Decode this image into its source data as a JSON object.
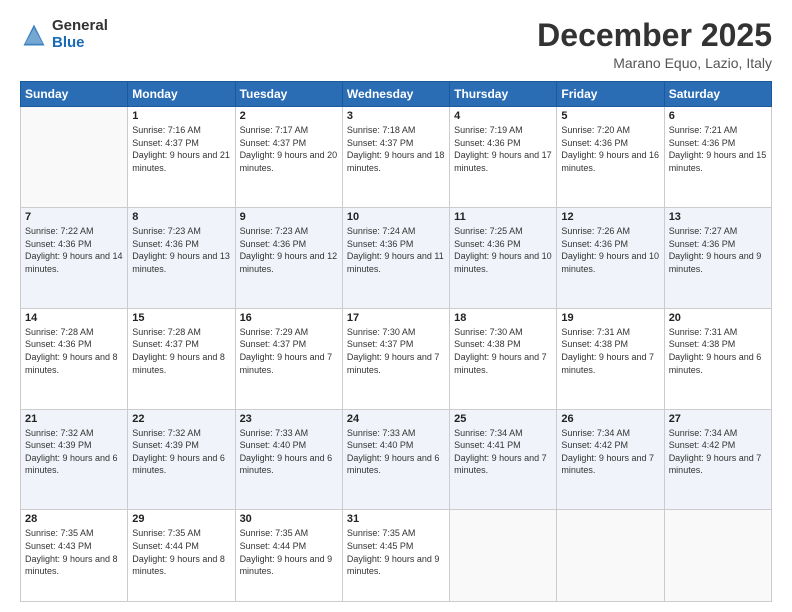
{
  "header": {
    "logo": {
      "line1": "General",
      "line2": "Blue"
    },
    "title": "December 2025",
    "location": "Marano Equo, Lazio, Italy"
  },
  "days_of_week": [
    "Sunday",
    "Monday",
    "Tuesday",
    "Wednesday",
    "Thursday",
    "Friday",
    "Saturday"
  ],
  "weeks": [
    [
      {
        "day": "",
        "sunrise": "",
        "sunset": "",
        "daylight": ""
      },
      {
        "day": "1",
        "sunrise": "Sunrise: 7:16 AM",
        "sunset": "Sunset: 4:37 PM",
        "daylight": "Daylight: 9 hours and 21 minutes."
      },
      {
        "day": "2",
        "sunrise": "Sunrise: 7:17 AM",
        "sunset": "Sunset: 4:37 PM",
        "daylight": "Daylight: 9 hours and 20 minutes."
      },
      {
        "day": "3",
        "sunrise": "Sunrise: 7:18 AM",
        "sunset": "Sunset: 4:37 PM",
        "daylight": "Daylight: 9 hours and 18 minutes."
      },
      {
        "day": "4",
        "sunrise": "Sunrise: 7:19 AM",
        "sunset": "Sunset: 4:36 PM",
        "daylight": "Daylight: 9 hours and 17 minutes."
      },
      {
        "day": "5",
        "sunrise": "Sunrise: 7:20 AM",
        "sunset": "Sunset: 4:36 PM",
        "daylight": "Daylight: 9 hours and 16 minutes."
      },
      {
        "day": "6",
        "sunrise": "Sunrise: 7:21 AM",
        "sunset": "Sunset: 4:36 PM",
        "daylight": "Daylight: 9 hours and 15 minutes."
      }
    ],
    [
      {
        "day": "7",
        "sunrise": "Sunrise: 7:22 AM",
        "sunset": "Sunset: 4:36 PM",
        "daylight": "Daylight: 9 hours and 14 minutes."
      },
      {
        "day": "8",
        "sunrise": "Sunrise: 7:23 AM",
        "sunset": "Sunset: 4:36 PM",
        "daylight": "Daylight: 9 hours and 13 minutes."
      },
      {
        "day": "9",
        "sunrise": "Sunrise: 7:23 AM",
        "sunset": "Sunset: 4:36 PM",
        "daylight": "Daylight: 9 hours and 12 minutes."
      },
      {
        "day": "10",
        "sunrise": "Sunrise: 7:24 AM",
        "sunset": "Sunset: 4:36 PM",
        "daylight": "Daylight: 9 hours and 11 minutes."
      },
      {
        "day": "11",
        "sunrise": "Sunrise: 7:25 AM",
        "sunset": "Sunset: 4:36 PM",
        "daylight": "Daylight: 9 hours and 10 minutes."
      },
      {
        "day": "12",
        "sunrise": "Sunrise: 7:26 AM",
        "sunset": "Sunset: 4:36 PM",
        "daylight": "Daylight: 9 hours and 10 minutes."
      },
      {
        "day": "13",
        "sunrise": "Sunrise: 7:27 AM",
        "sunset": "Sunset: 4:36 PM",
        "daylight": "Daylight: 9 hours and 9 minutes."
      }
    ],
    [
      {
        "day": "14",
        "sunrise": "Sunrise: 7:28 AM",
        "sunset": "Sunset: 4:36 PM",
        "daylight": "Daylight: 9 hours and 8 minutes."
      },
      {
        "day": "15",
        "sunrise": "Sunrise: 7:28 AM",
        "sunset": "Sunset: 4:37 PM",
        "daylight": "Daylight: 9 hours and 8 minutes."
      },
      {
        "day": "16",
        "sunrise": "Sunrise: 7:29 AM",
        "sunset": "Sunset: 4:37 PM",
        "daylight": "Daylight: 9 hours and 7 minutes."
      },
      {
        "day": "17",
        "sunrise": "Sunrise: 7:30 AM",
        "sunset": "Sunset: 4:37 PM",
        "daylight": "Daylight: 9 hours and 7 minutes."
      },
      {
        "day": "18",
        "sunrise": "Sunrise: 7:30 AM",
        "sunset": "Sunset: 4:38 PM",
        "daylight": "Daylight: 9 hours and 7 minutes."
      },
      {
        "day": "19",
        "sunrise": "Sunrise: 7:31 AM",
        "sunset": "Sunset: 4:38 PM",
        "daylight": "Daylight: 9 hours and 7 minutes."
      },
      {
        "day": "20",
        "sunrise": "Sunrise: 7:31 AM",
        "sunset": "Sunset: 4:38 PM",
        "daylight": "Daylight: 9 hours and 6 minutes."
      }
    ],
    [
      {
        "day": "21",
        "sunrise": "Sunrise: 7:32 AM",
        "sunset": "Sunset: 4:39 PM",
        "daylight": "Daylight: 9 hours and 6 minutes."
      },
      {
        "day": "22",
        "sunrise": "Sunrise: 7:32 AM",
        "sunset": "Sunset: 4:39 PM",
        "daylight": "Daylight: 9 hours and 6 minutes."
      },
      {
        "day": "23",
        "sunrise": "Sunrise: 7:33 AM",
        "sunset": "Sunset: 4:40 PM",
        "daylight": "Daylight: 9 hours and 6 minutes."
      },
      {
        "day": "24",
        "sunrise": "Sunrise: 7:33 AM",
        "sunset": "Sunset: 4:40 PM",
        "daylight": "Daylight: 9 hours and 6 minutes."
      },
      {
        "day": "25",
        "sunrise": "Sunrise: 7:34 AM",
        "sunset": "Sunset: 4:41 PM",
        "daylight": "Daylight: 9 hours and 7 minutes."
      },
      {
        "day": "26",
        "sunrise": "Sunrise: 7:34 AM",
        "sunset": "Sunset: 4:42 PM",
        "daylight": "Daylight: 9 hours and 7 minutes."
      },
      {
        "day": "27",
        "sunrise": "Sunrise: 7:34 AM",
        "sunset": "Sunset: 4:42 PM",
        "daylight": "Daylight: 9 hours and 7 minutes."
      }
    ],
    [
      {
        "day": "28",
        "sunrise": "Sunrise: 7:35 AM",
        "sunset": "Sunset: 4:43 PM",
        "daylight": "Daylight: 9 hours and 8 minutes."
      },
      {
        "day": "29",
        "sunrise": "Sunrise: 7:35 AM",
        "sunset": "Sunset: 4:44 PM",
        "daylight": "Daylight: 9 hours and 8 minutes."
      },
      {
        "day": "30",
        "sunrise": "Sunrise: 7:35 AM",
        "sunset": "Sunset: 4:44 PM",
        "daylight": "Daylight: 9 hours and 9 minutes."
      },
      {
        "day": "31",
        "sunrise": "Sunrise: 7:35 AM",
        "sunset": "Sunset: 4:45 PM",
        "daylight": "Daylight: 9 hours and 9 minutes."
      },
      {
        "day": "",
        "sunrise": "",
        "sunset": "",
        "daylight": ""
      },
      {
        "day": "",
        "sunrise": "",
        "sunset": "",
        "daylight": ""
      },
      {
        "day": "",
        "sunrise": "",
        "sunset": "",
        "daylight": ""
      }
    ]
  ]
}
